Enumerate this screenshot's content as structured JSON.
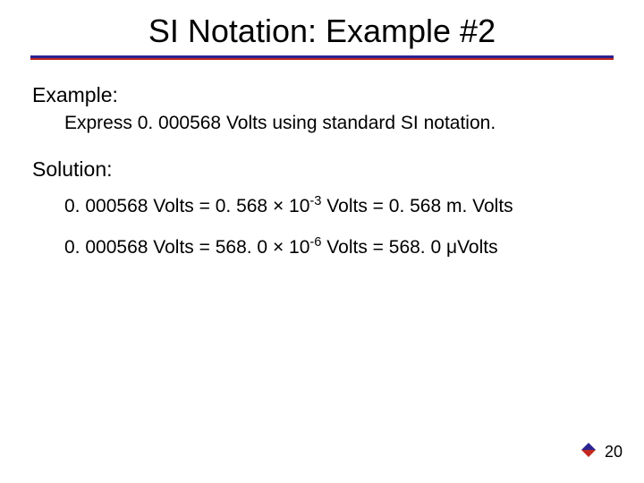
{
  "title": "SI Notation: Example #2",
  "example_label": "Example:",
  "problem_text": "Express 0. 000568 Volts using standard SI notation.",
  "solution_label": "Solution:",
  "eq1": {
    "lhs": "0. 000568 Volts = 0. 568 × 10",
    "exp": "-3",
    "rhs": " Volts = 0. 568 m. Volts"
  },
  "eq2": {
    "lhs": "0. 000568 Volts = 568. 0 × 10",
    "exp": "-6",
    "rhs": " Volts = 568. 0 μVolts"
  },
  "page_number": "20"
}
